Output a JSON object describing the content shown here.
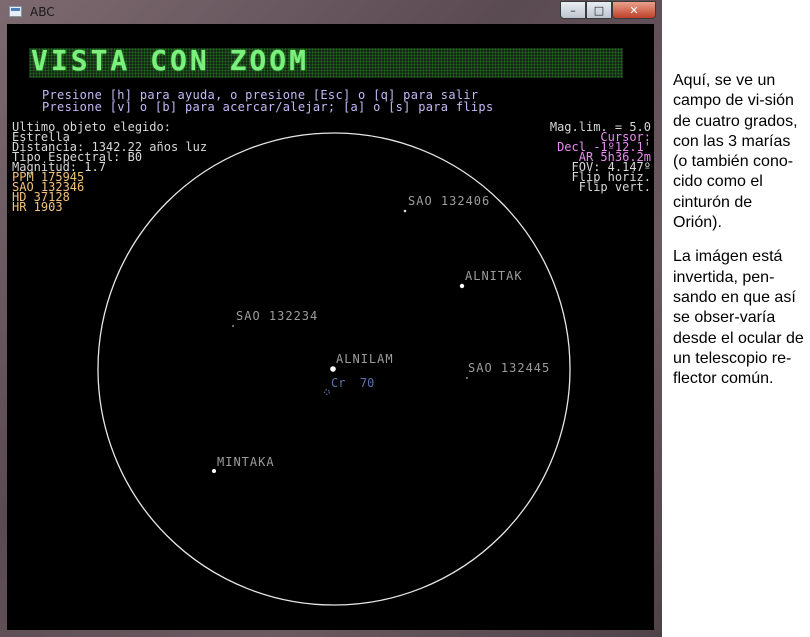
{
  "window": {
    "title": "ABC",
    "minimize_glyph": "–",
    "maximize_glyph": "□",
    "close_glyph": "✕"
  },
  "banner": {
    "text": "VISTA CON ZOOM"
  },
  "help": {
    "line1": "Presione [h] para ayuda, o presione [Esc] o [q] para salir",
    "line2": "Presione [v] o [b] para acercar/alejar; [a] o [s] para flips"
  },
  "info": {
    "heading": "Ultimo objeto elegido:",
    "type": "Estrella",
    "distance": "Distancia: 1342.22 años luz",
    "spectral": "Tipo Espectral: B0",
    "magnitude": "Magnitud: 1.7",
    "catalogs": [
      "PPM 175945",
      "SAO 132346",
      "HD 37128",
      "HR 1903"
    ]
  },
  "status": {
    "mag_limit": "Mag.lim. = 5.0",
    "cursor": "Cursor:",
    "dec": "Decl -1º12.1'",
    "ra": "AR 5h36.2m",
    "fov": "FOV: 4.147º",
    "flip_h": "Flip horiz.",
    "flip_v": "Flip vert."
  },
  "stars": [
    {
      "label": "SAO 132406"
    },
    {
      "label": "ALNITAK"
    },
    {
      "label": "SAO 132234"
    },
    {
      "label": "ALNILAM"
    },
    {
      "label": "SAO 132445"
    },
    {
      "label": "MINTAKA"
    }
  ],
  "cluster": {
    "label": "Cr  70"
  },
  "description": {
    "para1": "Aquí, se ve un campo de vi-sión de cuatro grados, con las 3 marías (o también cono-cido como el cinturón de Orión).",
    "para2": "La imágen está invertida, pen-sando en que así se obser-varía desde el ocular de un telescopio re-flector común."
  },
  "colors": {
    "background": "#000000",
    "banner_text": "#7cf07c",
    "help_text": "#c6b8f6",
    "catalog_text": "#f3c27a",
    "cursor_text": "#e98df0",
    "cluster_text": "#5c72b0"
  }
}
